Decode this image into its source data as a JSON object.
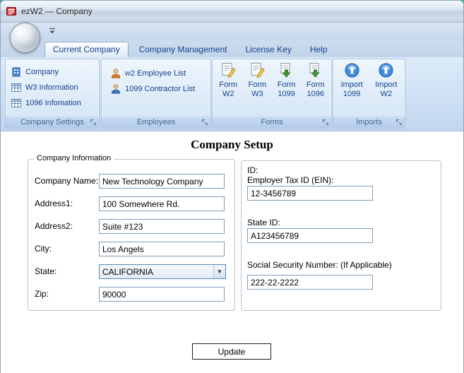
{
  "window": {
    "title": "ezW2 --- Company"
  },
  "tabs": [
    {
      "label": "Current Company"
    },
    {
      "label": "Company Management"
    },
    {
      "label": "License Key"
    },
    {
      "label": "Help"
    }
  ],
  "ribbon": {
    "company_settings": {
      "caption": "Company Settings",
      "items": [
        {
          "label": "Company"
        },
        {
          "label": "W3 Information"
        },
        {
          "label": "1096 Infomation"
        }
      ]
    },
    "employees": {
      "caption": "Employees",
      "items": [
        {
          "label": "w2 Employee List"
        },
        {
          "label": "1099 Contractor List"
        }
      ]
    },
    "forms": {
      "caption": "Forms",
      "items": [
        {
          "line1": "Form",
          "line2": "W2"
        },
        {
          "line1": "Form",
          "line2": "W3"
        },
        {
          "line1": "Form",
          "line2": "1099"
        },
        {
          "line1": "Form",
          "line2": "1096"
        }
      ]
    },
    "imports": {
      "caption": "Imports",
      "items": [
        {
          "line1": "Import",
          "line2": "1099"
        },
        {
          "line1": "Import",
          "line2": "W2"
        }
      ]
    }
  },
  "main": {
    "heading": "Company Setup",
    "company_info": {
      "legend": "Company Information",
      "fields": [
        {
          "label": "Company Name:",
          "value": "New Technology Company"
        },
        {
          "label": "Address1:",
          "value": "100 Somewhere Rd."
        },
        {
          "label": "Address2:",
          "value": "Suite #123"
        },
        {
          "label": "City:",
          "value": "Los Angels"
        },
        {
          "label": "State:",
          "value": "CALIFORNIA"
        },
        {
          "label": "Zip:",
          "value": "90000"
        }
      ]
    },
    "id_section": {
      "heading": "ID:",
      "fields": [
        {
          "label": "Employer Tax ID (EIN):",
          "value": "12-3456789"
        },
        {
          "label": "State ID:",
          "value": "A123456789"
        },
        {
          "label": "Social Security Number: (If Applicable)",
          "value": "222-22-2222"
        }
      ]
    },
    "update_button": "Update"
  },
  "icons": {
    "app": "red-ezw2-app-icon",
    "company": "building-icon",
    "w3_information": "table-icon",
    "info_1096": "table-icon",
    "employee_list": "person-orange-icon",
    "contractor_list": "person-blue-icon",
    "form_w2_w3": "document-pencil-icon",
    "form_1099_1096": "document-green-arrow-icon",
    "imports": "blue-orb-up-arrow-icon",
    "group_launcher": "dialog-launcher-icon"
  },
  "colors": {
    "accent_text": "#15428b",
    "caption_text": "#3e6792",
    "field_border": "#7f9db9",
    "desktop": "#45a8a0",
    "app_red": "#cc2127"
  }
}
